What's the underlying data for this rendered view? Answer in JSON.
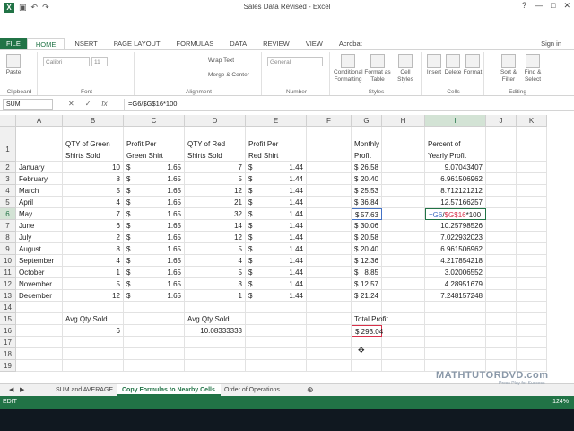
{
  "window": {
    "title": "Sales Data Revised - Excel",
    "app_logo": "X",
    "controls": [
      "?",
      "—",
      "□",
      "✕"
    ]
  },
  "ribbon": {
    "tabs": [
      "FILE",
      "HOME",
      "INSERT",
      "PAGE LAYOUT",
      "FORMULAS",
      "DATA",
      "REVIEW",
      "VIEW",
      "Acrobat"
    ],
    "active_tab": "HOME",
    "sign_in": "Sign in",
    "groups": [
      "Clipboard",
      "Font",
      "Alignment",
      "Number",
      "Styles",
      "Cells",
      "Editing"
    ],
    "paste_label": "Paste",
    "font_name": "Calibri",
    "font_size": "11",
    "number_format": "General",
    "wrap_text": "Wrap Text",
    "merge_center": "Merge & Center",
    "conditional": "Conditional Formatting",
    "format_table": "Format as Table",
    "cell_styles": "Cell Styles",
    "insert": "Insert",
    "delete": "Delete",
    "format": "Format",
    "sort_filter": "Sort & Filter",
    "find_select": "Find & Select"
  },
  "formula_bar": {
    "name_box": "SUM",
    "cancel": "✕",
    "enter": "✓",
    "fx": "fx",
    "formula": "=G6/$G$16*100"
  },
  "columns": [
    "A",
    "B",
    "C",
    "D",
    "E",
    "F",
    "G",
    "H",
    "I",
    "J",
    "K"
  ],
  "rows": [
    "1",
    "2",
    "3",
    "4",
    "5",
    "6",
    "7",
    "8",
    "9",
    "10",
    "11",
    "12",
    "13",
    "14",
    "15",
    "16",
    "17",
    "18",
    "19"
  ],
  "headers": {
    "b": [
      "QTY of Green",
      "Shirts Sold"
    ],
    "c": [
      "Profit Per",
      "Green Shirt"
    ],
    "d": [
      "QTY of Red",
      "Shirts Sold"
    ],
    "e": [
      "Profit Per",
      "Red Shirt"
    ],
    "g": [
      "Monthly",
      "Profit"
    ],
    "i": [
      "Percent of",
      "Yearly Profit"
    ]
  },
  "data_rows": [
    {
      "month": "January",
      "green_qty": "10",
      "green_profit": "1.65",
      "red_qty": "7",
      "red_profit": "1.44",
      "monthly": "26.58",
      "pct": "9.07043407"
    },
    {
      "month": "February",
      "green_qty": "8",
      "green_profit": "1.65",
      "red_qty": "5",
      "red_profit": "1.44",
      "monthly": "20.40",
      "pct": "6.961506962"
    },
    {
      "month": "March",
      "green_qty": "5",
      "green_profit": "1.65",
      "red_qty": "12",
      "red_profit": "1.44",
      "monthly": "25.53",
      "pct": "8.712121212"
    },
    {
      "month": "April",
      "green_qty": "4",
      "green_profit": "1.65",
      "red_qty": "21",
      "red_profit": "1.44",
      "monthly": "36.84",
      "pct": "12.57166257"
    },
    {
      "month": "May",
      "green_qty": "7",
      "green_profit": "1.65",
      "red_qty": "32",
      "red_profit": "1.44",
      "monthly": "57.63",
      "pct": ""
    },
    {
      "month": "June",
      "green_qty": "6",
      "green_profit": "1.65",
      "red_qty": "14",
      "red_profit": "1.44",
      "monthly": "30.06",
      "pct": "10.25798526"
    },
    {
      "month": "July",
      "green_qty": "2",
      "green_profit": "1.65",
      "red_qty": "12",
      "red_profit": "1.44",
      "monthly": "20.58",
      "pct": "7.022932023"
    },
    {
      "month": "August",
      "green_qty": "8",
      "green_profit": "1.65",
      "red_qty": "5",
      "red_profit": "1.44",
      "monthly": "20.40",
      "pct": "6.961506962"
    },
    {
      "month": "September",
      "green_qty": "4",
      "green_profit": "1.65",
      "red_qty": "4",
      "red_profit": "1.44",
      "monthly": "12.36",
      "pct": "4.217854218"
    },
    {
      "month": "October",
      "green_qty": "1",
      "green_profit": "1.65",
      "red_qty": "5",
      "red_profit": "1.44",
      "monthly": "8.85",
      "pct": "3.02006552"
    },
    {
      "month": "November",
      "green_qty": "5",
      "green_profit": "1.65",
      "red_qty": "3",
      "red_profit": "1.44",
      "monthly": "12.57",
      "pct": "4.28951679"
    },
    {
      "month": "December",
      "green_qty": "12",
      "green_profit": "1.65",
      "red_qty": "1",
      "red_profit": "1.44",
      "monthly": "21.24",
      "pct": "7.248157248"
    }
  ],
  "edit_cell_formula": {
    "a": "=G6",
    "sep": "/",
    "b": "$G$16",
    "rest": "*100"
  },
  "summary": {
    "avg_green_label": "Avg Qty Sold",
    "avg_green_value": "6",
    "avg_red_label": "Avg Qty Sold",
    "avg_red_value": "10.08333333",
    "total_label": "Total Profit",
    "total_value": "$ 293.04"
  },
  "currency": "$",
  "sheets": {
    "nav": [
      "◀",
      "▶"
    ],
    "ellipsis": "...",
    "tabs": [
      "SUM and AVERAGE",
      "Copy Formulas to Nearby Cells",
      "Order of Operations"
    ],
    "active": "Copy Formulas to Nearby Cells",
    "add": "⊕"
  },
  "status": {
    "mode": "EDIT",
    "zoom": "124%"
  },
  "watermark": {
    "title": "MATHTUTORDVD.com",
    "subtitle": "Press Play for Success"
  }
}
